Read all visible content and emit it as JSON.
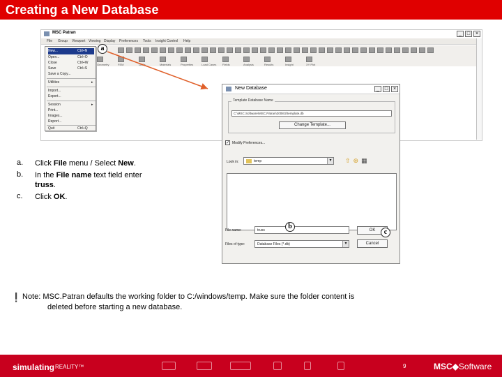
{
  "slide": {
    "title": "Creating a New Database"
  },
  "patran_window": {
    "title": "MSC Patran",
    "menus": [
      "File",
      "Group",
      "Viewport",
      "Viewing",
      "Display",
      "Preferences",
      "Tools",
      "Insight Control",
      "Help"
    ],
    "toolbar_labels": [
      "Geometry",
      "FEM",
      "LBCs",
      "Materials",
      "Properties",
      "Load Cases",
      "Fields",
      "Analysis",
      "Results",
      "Insight",
      "XY Plot"
    ],
    "window_buttons": [
      "_",
      "□",
      "×"
    ]
  },
  "file_menu": {
    "items": [
      {
        "label": "New...",
        "shortcut": "Ctrl+N",
        "selected": true
      },
      {
        "label": "Open...",
        "shortcut": "Ctrl+O"
      },
      {
        "label": "Close",
        "shortcut": "Ctrl+W"
      },
      {
        "label": "Save",
        "shortcut": "Ctrl+S"
      },
      {
        "label": "Save a Copy...",
        "shortcut": ""
      },
      {
        "label": "Utilities",
        "shortcut": "▸"
      },
      {
        "label": "Import...",
        "shortcut": ""
      },
      {
        "label": "Export...",
        "shortcut": ""
      },
      {
        "label": "Session",
        "shortcut": "▸"
      },
      {
        "label": "Print...",
        "shortcut": ""
      },
      {
        "label": "Images...",
        "shortcut": ""
      },
      {
        "label": "Report...",
        "shortcut": ""
      },
      {
        "label": "Quit",
        "shortcut": "Ctrl+Q"
      }
    ]
  },
  "dialog": {
    "title": "New Database",
    "template_group": "Template Database Name",
    "template_path": "C:\\MSC.Software\\MSC.Patran\\2008r2\\template.db",
    "change_template_button": "Change Template...",
    "modify_preferences": "Modify Preferences...",
    "look_in_label": "Look in:",
    "look_in_value": "temp",
    "file_name_label": "File name:",
    "file_name_value": "truss",
    "files_of_type_label": "Files of type:",
    "files_of_type_value": "Database Files (*.db)",
    "ok_button": "OK",
    "cancel_button": "Cancel"
  },
  "markers": {
    "a": "a",
    "b": "b",
    "c": "c"
  },
  "steps": [
    {
      "letter": "a.",
      "pre": "Click ",
      "bold": "File",
      "mid": " menu / Select ",
      "bold2": "New",
      "post": "."
    },
    {
      "letter": "b.",
      "pre": "In the ",
      "bold": "File name",
      "mid": " text field enter ",
      "bold2": "truss",
      "post": "."
    },
    {
      "letter": "c.",
      "pre": "Click ",
      "bold": "OK",
      "mid": "",
      "bold2": "",
      "post": "."
    }
  ],
  "note": {
    "label": "Note",
    "line1": ": MSC.Patran defaults the working folder to C:/windows/temp. Make sure the folder content is",
    "line2": "deleted before starting a new database."
  },
  "footer": {
    "tagline": "simulating",
    "tagline2": "REALITY™",
    "page_number": "9",
    "logo_main": "MSC",
    "logo_sep": "◆",
    "logo_sub": "Software"
  },
  "colors": {
    "brand_red": "#e00000",
    "footer_red": "#c8001e",
    "arrow": "#e0602a"
  }
}
